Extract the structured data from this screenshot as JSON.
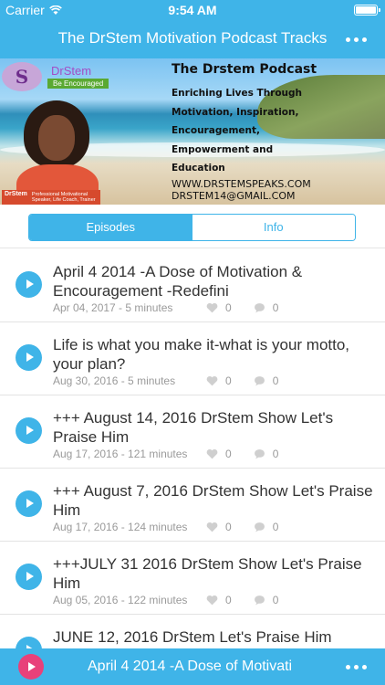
{
  "status": {
    "carrier": "Carrier",
    "time": "9:54 AM"
  },
  "nav": {
    "title": "The DrStem Motivation Podcast Tracks"
  },
  "banner": {
    "logo_letter": "S",
    "logo_name": "DrStem",
    "logo_tagline": "Be Encouraged",
    "heading": "The Drstem Podcast",
    "lines": [
      "Enriching Lives Through",
      "Motivation, Inspiration,",
      "Encouragement,",
      "Empowerment and",
      "Education"
    ],
    "website": "WWW.DRSTEMSPEAKS.COM",
    "email": "DRSTEM14@GMAIL.COM",
    "stamp_name": "DrStem",
    "stamp_text": "Professional Motivational Speaker, Life Coach, Trainer"
  },
  "segment": {
    "episodes_label": "Episodes",
    "info_label": "Info"
  },
  "episodes": [
    {
      "title": "April 4 2014 -A Dose of Motivation & Encouragement -Redefini",
      "meta": "Apr 04, 2017 - 5 minutes",
      "likes": "0",
      "comments": "0"
    },
    {
      "title": "Life is what you make it-what is your motto, your plan?",
      "meta": "Aug 30, 2016 - 5 minutes",
      "likes": "0",
      "comments": "0"
    },
    {
      "title": "+++ August 14, 2016 DrStem Show Let's Praise Him",
      "meta": "Aug 17, 2016 - 121 minutes",
      "likes": "0",
      "comments": "0"
    },
    {
      "title": "+++ August 7, 2016 DrStem Show Let's Praise Him",
      "meta": "Aug 17, 2016 - 124 minutes",
      "likes": "0",
      "comments": "0"
    },
    {
      "title": "+++JULY 31 2016 DrStem Show Let's Praise Him",
      "meta": "Aug 05, 2016 - 122 minutes",
      "likes": "0",
      "comments": "0"
    },
    {
      "title": "JUNE 12, 2016 DrStem Let's Praise Him",
      "meta": "",
      "likes": "",
      "comments": ""
    }
  ],
  "player": {
    "now_playing": "April 4 2014 -A Dose of Motivati"
  },
  "colors": {
    "accent": "#3fb4e8",
    "record": "#e8417a"
  }
}
